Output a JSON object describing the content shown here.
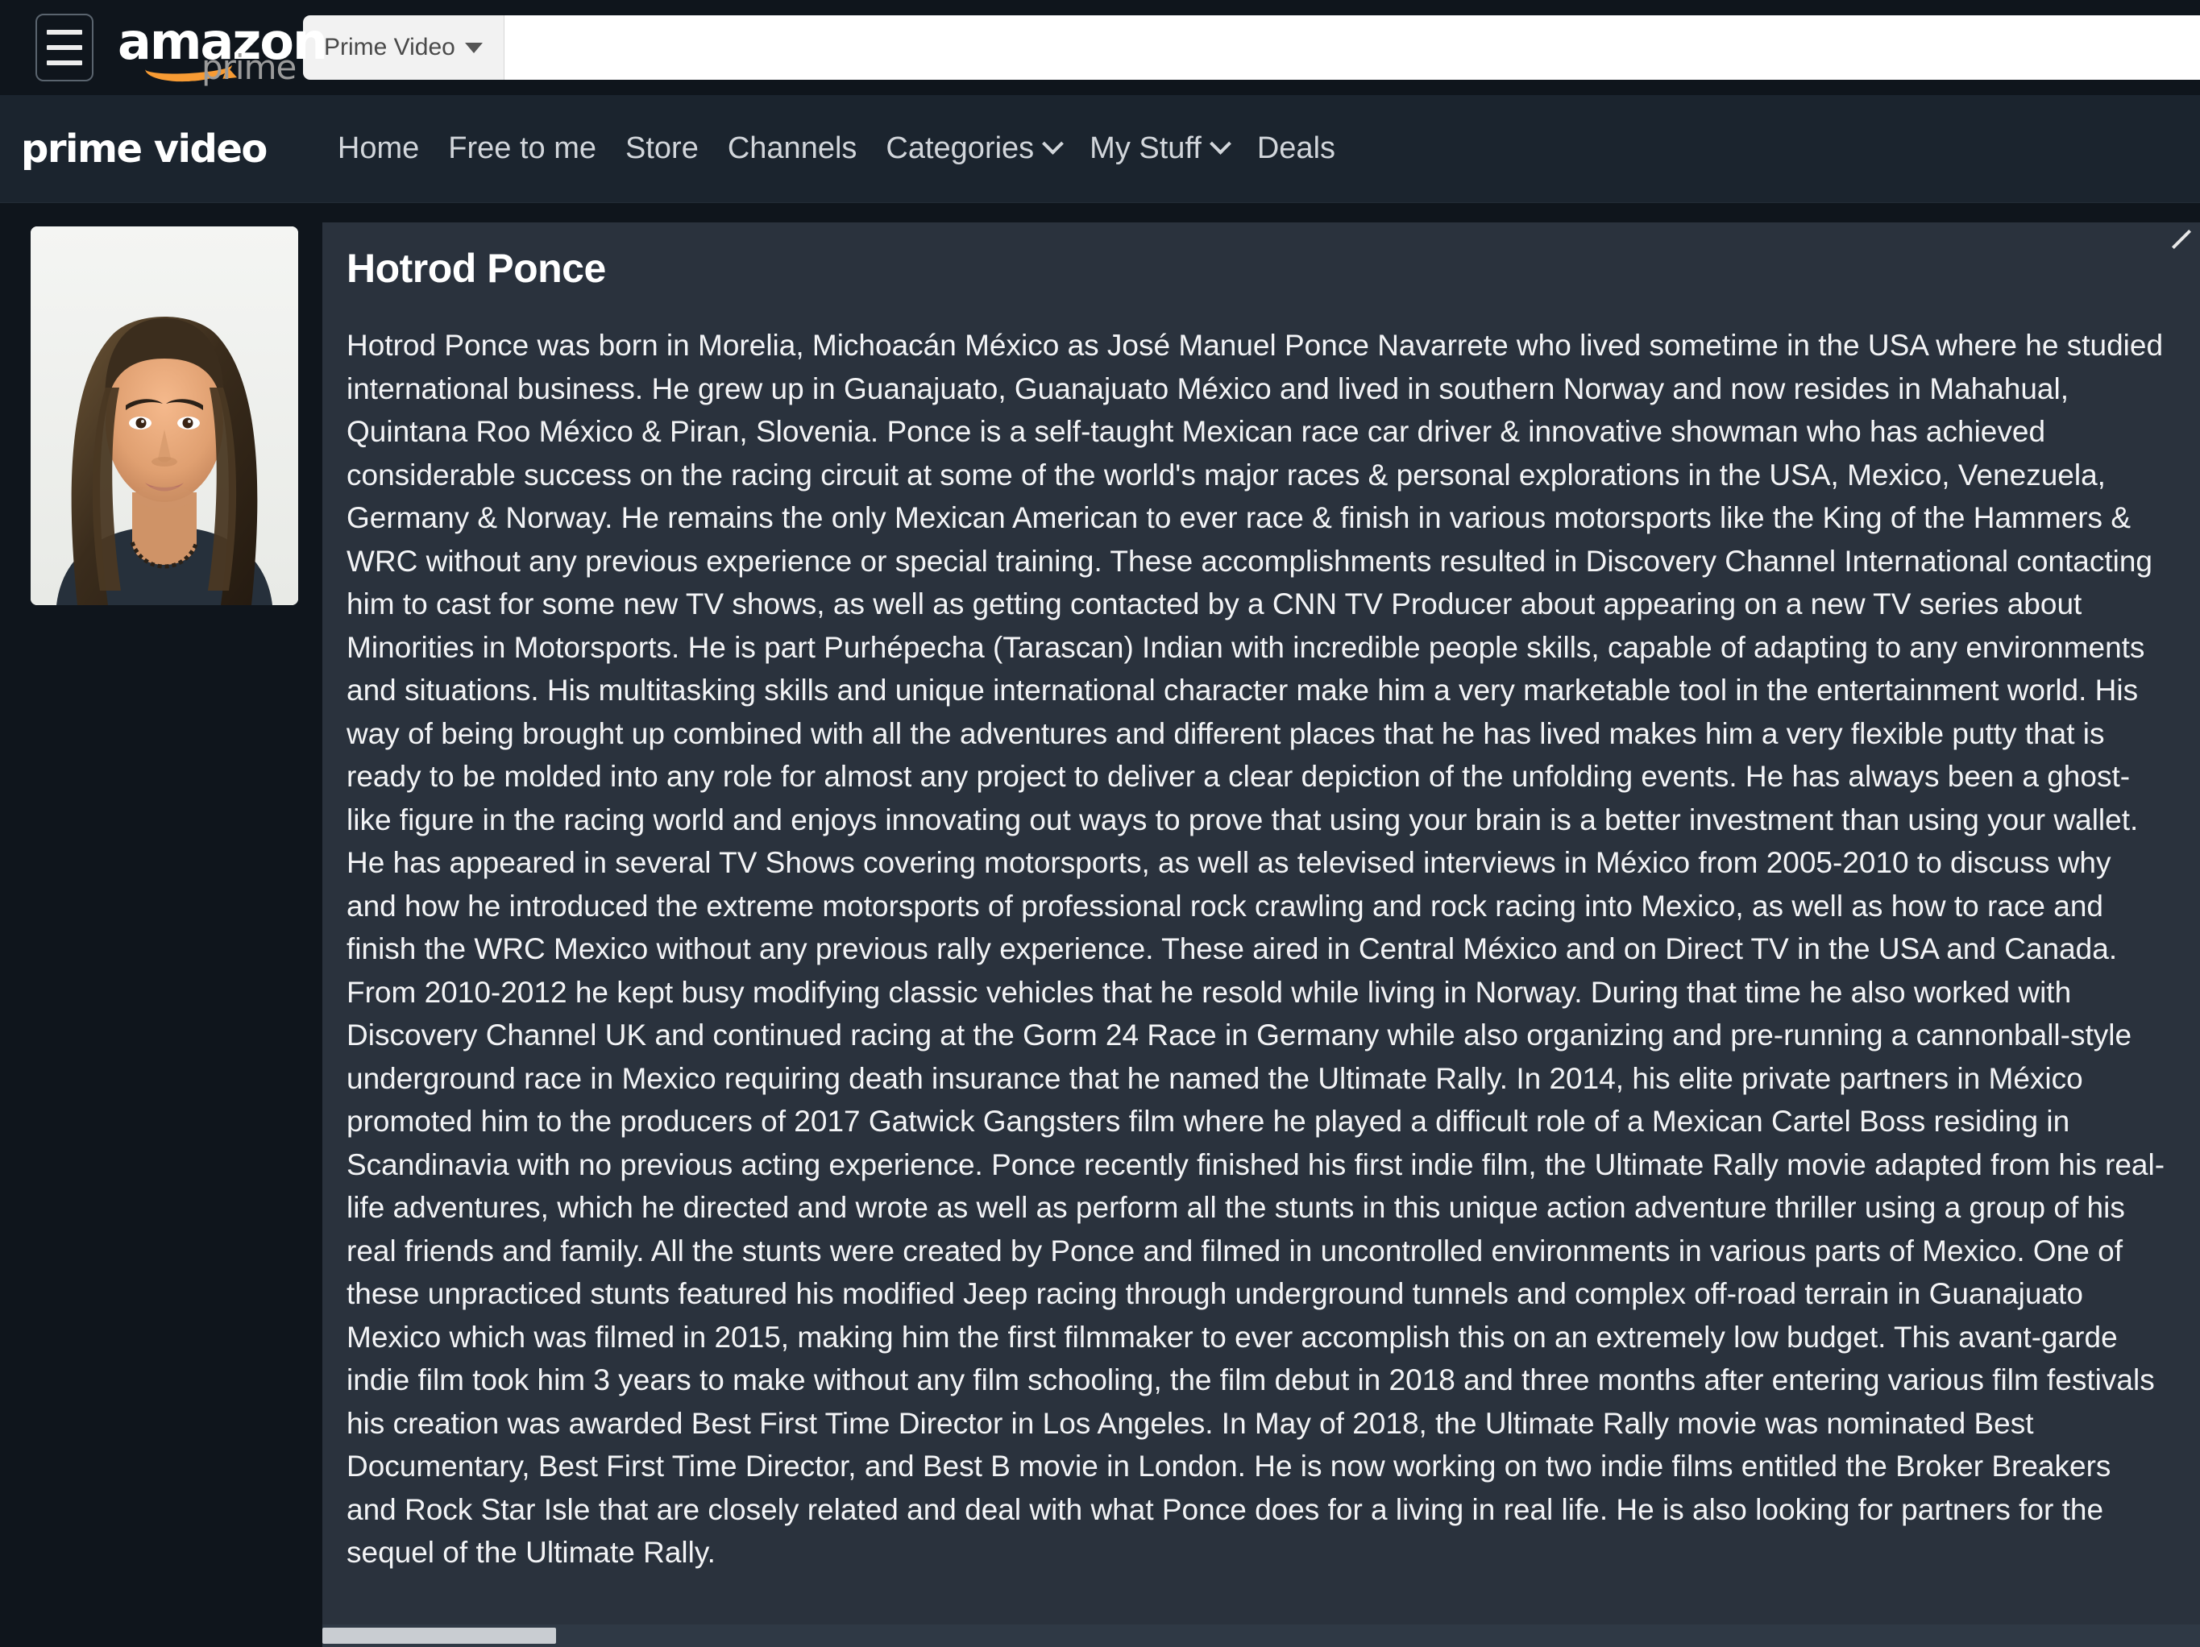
{
  "topbar": {
    "menu_icon": "hamburger-menu-icon",
    "logo": {
      "wordmark": "amazon",
      "subword": "prime"
    },
    "search": {
      "scope_label": "Prime Video",
      "scope_caret_icon": "caret-down-icon",
      "input_value": "",
      "input_placeholder": ""
    }
  },
  "nav": {
    "brand": "prime video",
    "items": [
      {
        "label": "Home",
        "has_chevron": false
      },
      {
        "label": "Free to me",
        "has_chevron": false
      },
      {
        "label": "Store",
        "has_chevron": false
      },
      {
        "label": "Channels",
        "has_chevron": false
      },
      {
        "label": "Categories",
        "has_chevron": true
      },
      {
        "label": "My Stuff",
        "has_chevron": true
      },
      {
        "label": "Deals",
        "has_chevron": false
      }
    ]
  },
  "main": {
    "photo_alt": "Hotrod Ponce headshot portrait",
    "title": "Hotrod Ponce",
    "biography": "Hotrod Ponce was born in Morelia, Michoacán México as José Manuel Ponce Navarrete who lived sometime in the USA where he studied international business. He grew up in Guanajuato, Guanajuato México and lived in southern Norway and now resides in Mahahual, Quintana Roo México & Piran, Slovenia. Ponce is a self-taught Mexican race car driver & innovative showman who has achieved considerable success on the racing circuit at some of the world's major races & personal explorations in the USA, Mexico, Venezuela, Germany & Norway. He remains the only Mexican American to ever race & finish in various motorsports like the King of the Hammers & WRC without any previous experience or special training. These accomplishments resulted in Discovery Channel International contacting him to cast for some new TV shows, as well as getting contacted by a CNN TV Producer about appearing on a new TV series about Minorities in Motorsports. He is part Purhépecha (Tarascan) Indian with incredible people skills, capable of adapting to any environments and situations. His multitasking skills and unique international character make him a very marketable tool in the entertainment world. His way of being brought up combined with all the adventures and different places that he has lived makes him a very flexible putty that is ready to be molded into any role for almost any project to deliver a clear depiction of the unfolding events. He has always been a ghost-like figure in the racing world and enjoys innovating out ways to prove that using your brain is a better investment than using your wallet. He has appeared in several TV Shows covering motorsports, as well as televised interviews in México from 2005-2010 to discuss why and how he introduced the extreme motorsports of professional rock crawling and rock racing into Mexico, as well as how to race and finish the WRC Mexico without any previous rally experience. These aired in Central México and on Direct TV in the USA and Canada. From 2010-2012 he kept busy modifying classic vehicles that he resold while living in Norway. During that time he also worked with Discovery Channel UK and continued racing at the Gorm 24 Race in Germany while also organizing and pre-running a cannonball-style underground race in Mexico requiring death insurance that he named the Ultimate Rally. In 2014, his elite private partners in México promoted him to the producers of 2017 Gatwick Gangsters film where he played a difficult role of a Mexican Cartel Boss residing in Scandinavia with no previous acting experience. Ponce recently finished his first indie film, the Ultimate Rally movie adapted from his real-life adventures, which he directed and wrote as well as perform all the stunts in this unique action adventure thriller using a group of his real friends and family. All the stunts were created by Ponce and filmed in uncontrolled environments in various parts of Mexico. One of these unpracticed stunts featured his modified Jeep racing through underground tunnels and complex off-road terrain in Guanajuato Mexico which was filmed in 2015, making him the first filmmaker to ever accomplish this on an extremely low budget. This avant-garde indie film took him 3 years to make without any film schooling, the film debut in 2018 and three months after entering various film festivals his creation was awarded Best First Time Director in Los Angeles. In May of 2018, the Ultimate Rally movie was nominated Best Documentary, Best First Time Director, and Best B movie in London. He is now working on two indie films entitled the Broker Breakers and Rock Star Isle that are closely related and deal with what Ponce does for a living in real life. He is also looking for partners for the sequel of the Ultimate Rally.",
    "resize_icon": "resize-handle-icon"
  },
  "colors": {
    "page_background": "#0F151C",
    "nav_background": "#1B242E",
    "panel_background": "#2A323D",
    "accent_orange": "#F79B34",
    "text_primary": "#FFFFFF",
    "text_nav": "#D2D6DB"
  }
}
